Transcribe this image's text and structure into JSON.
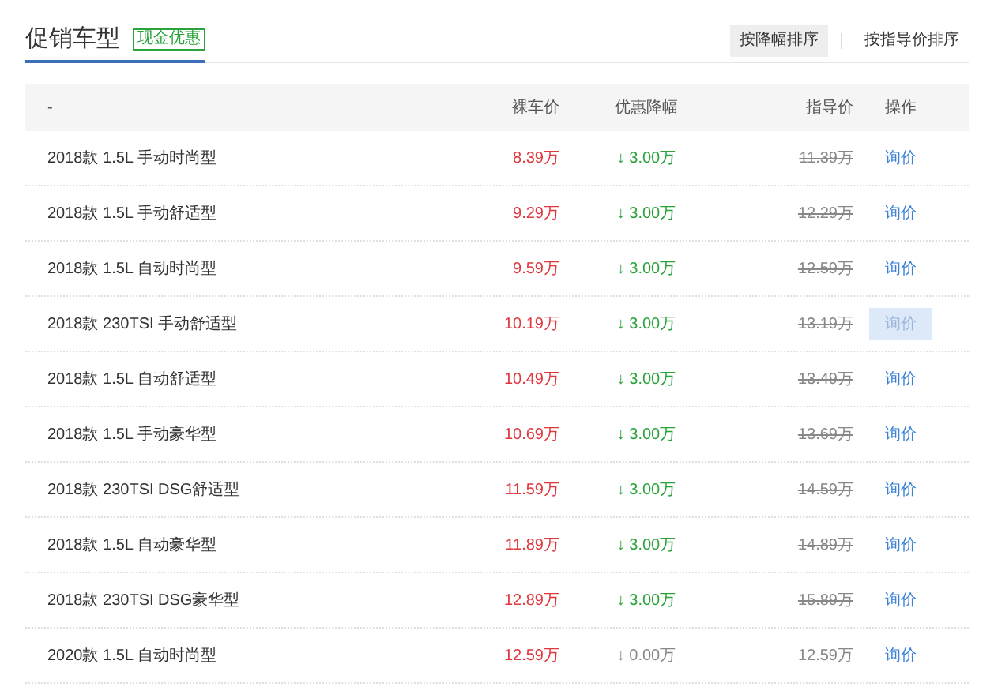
{
  "title": "促销车型",
  "tag": "现金优惠",
  "sort_buttons": [
    {
      "label": "按降幅排序",
      "selected": true
    },
    {
      "label": "按指导价排序",
      "selected": false
    }
  ],
  "table": {
    "columns": [
      "-",
      "裸车价",
      "优惠降幅",
      "指导价",
      "操作"
    ],
    "rows": [
      {
        "name": "2018款 1.5L 手动时尚型",
        "price": "8.39万",
        "arrow": "↓",
        "discount": "3.00万",
        "discounted": true,
        "guide": "11.39万",
        "action": "询价",
        "highlighted": false
      },
      {
        "name": "2018款 1.5L 手动舒适型",
        "price": "9.29万",
        "arrow": "↓",
        "discount": "3.00万",
        "discounted": true,
        "guide": "12.29万",
        "action": "询价",
        "highlighted": false
      },
      {
        "name": "2018款 1.5L 自动时尚型",
        "price": "9.59万",
        "arrow": "↓",
        "discount": "3.00万",
        "discounted": true,
        "guide": "12.59万",
        "action": "询价",
        "highlighted": false
      },
      {
        "name": "2018款 230TSI 手动舒适型",
        "price": "10.19万",
        "arrow": "↓",
        "discount": "3.00万",
        "discounted": true,
        "guide": "13.19万",
        "action": "询价",
        "highlighted": true
      },
      {
        "name": "2018款 1.5L 自动舒适型",
        "price": "10.49万",
        "arrow": "↓",
        "discount": "3.00万",
        "discounted": true,
        "guide": "13.49万",
        "action": "询价",
        "highlighted": false
      },
      {
        "name": "2018款 1.5L 手动豪华型",
        "price": "10.69万",
        "arrow": "↓",
        "discount": "3.00万",
        "discounted": true,
        "guide": "13.69万",
        "action": "询价",
        "highlighted": false
      },
      {
        "name": "2018款 230TSI DSG舒适型",
        "price": "11.59万",
        "arrow": "↓",
        "discount": "3.00万",
        "discounted": true,
        "guide": "14.59万",
        "action": "询价",
        "highlighted": false
      },
      {
        "name": "2018款 1.5L 自动豪华型",
        "price": "11.89万",
        "arrow": "↓",
        "discount": "3.00万",
        "discounted": true,
        "guide": "14.89万",
        "action": "询价",
        "highlighted": false
      },
      {
        "name": "2018款 230TSI DSG豪华型",
        "price": "12.89万",
        "arrow": "↓",
        "discount": "3.00万",
        "discounted": true,
        "guide": "15.89万",
        "action": "询价",
        "highlighted": false
      },
      {
        "name": "2020款 1.5L 自动时尚型",
        "price": "12.59万",
        "arrow": "↓",
        "discount": "0.00万",
        "discounted": false,
        "guide": "12.59万",
        "action": "询价",
        "highlighted": false
      }
    ]
  }
}
